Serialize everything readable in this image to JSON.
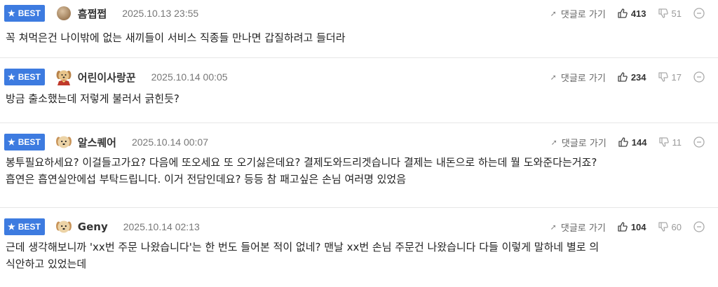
{
  "ui": {
    "best_label": "BEST",
    "reply_label": "댓글로 가기"
  },
  "colors": {
    "badge": "#3d7be0",
    "divider": "#e6e6e6"
  },
  "comments": [
    {
      "nickname": "흠쩝쩝",
      "avatar_icon": "brown-circle-icon",
      "date": "2025.10.13 23:55",
      "upvotes": "413",
      "downvotes": "51",
      "text": "꼭 쳐먹은건 나이밖에 없는 새끼들이 서비스 직종들 만나면 갑질하려고 들더라"
    },
    {
      "nickname": "어린이사랑꾼",
      "avatar_icon": "puppy-cape-icon",
      "date": "2025.10.14 00:05",
      "upvotes": "234",
      "downvotes": "17",
      "text": "방금 출소했는데 저렇게 불러서 긁힌듯?"
    },
    {
      "nickname": "알스퀘어",
      "avatar_icon": "puppy-icon",
      "date": "2025.10.14 00:07",
      "upvotes": "144",
      "downvotes": "11",
      "text_line1": "봉투필요하세요? 이걸들고가요? 다음에 또오세요 또 오기싫은데요? 결제도와드리겟습니다 결제는 내돈으로 하는데 뭘 도와준다는거죠?",
      "text_line2": "흡연은 흡연실안에섭 부탁드립니다. 이거 전담인데요? 등등 참 패고싶은 손님 여러명 있었음"
    },
    {
      "nickname": "Geny",
      "avatar_icon": "puppy-icon",
      "date": "2025.10.14 02:13",
      "upvotes": "104",
      "downvotes": "60",
      "text_line1": "근데 생각해보니까 'xx번 주문 나왔습니다'는 한 번도 들어본 적이 없네? 맨날 xx번 손님 주문건 나왔습니다 다들 이렇게 말하네 별로 의",
      "text_line2": "식안하고 있었는데"
    }
  ]
}
